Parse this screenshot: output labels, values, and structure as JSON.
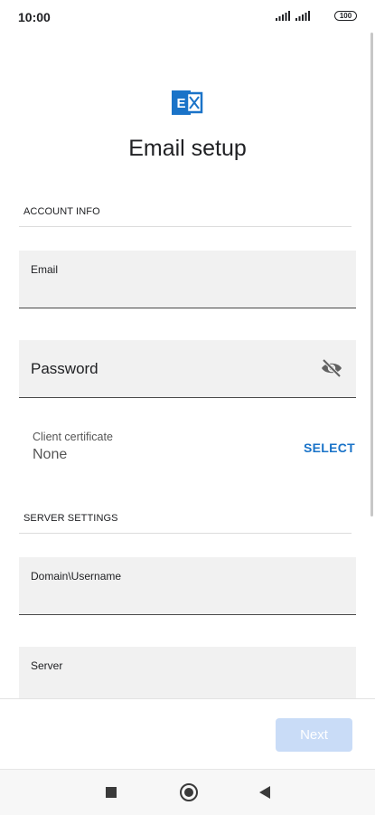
{
  "status_bar": {
    "time": "10:00",
    "battery": "100"
  },
  "header": {
    "title": "Email setup",
    "logo_icon": "exchange-icon"
  },
  "account_info": {
    "header": "ACCOUNT INFO",
    "email_label": "Email",
    "password_label": "Password",
    "client_certificate_label": "Client certificate",
    "client_certificate_value": "None",
    "select_label": "SELECT"
  },
  "server_settings": {
    "header": "SERVER SETTINGS",
    "domain_username_label": "Domain\\Username",
    "server_label": "Server"
  },
  "footer": {
    "next_label": "Next"
  },
  "colors": {
    "accent": "#1a73c8",
    "next_disabled": "#c9dcf7",
    "logo": "#1a73c8"
  }
}
